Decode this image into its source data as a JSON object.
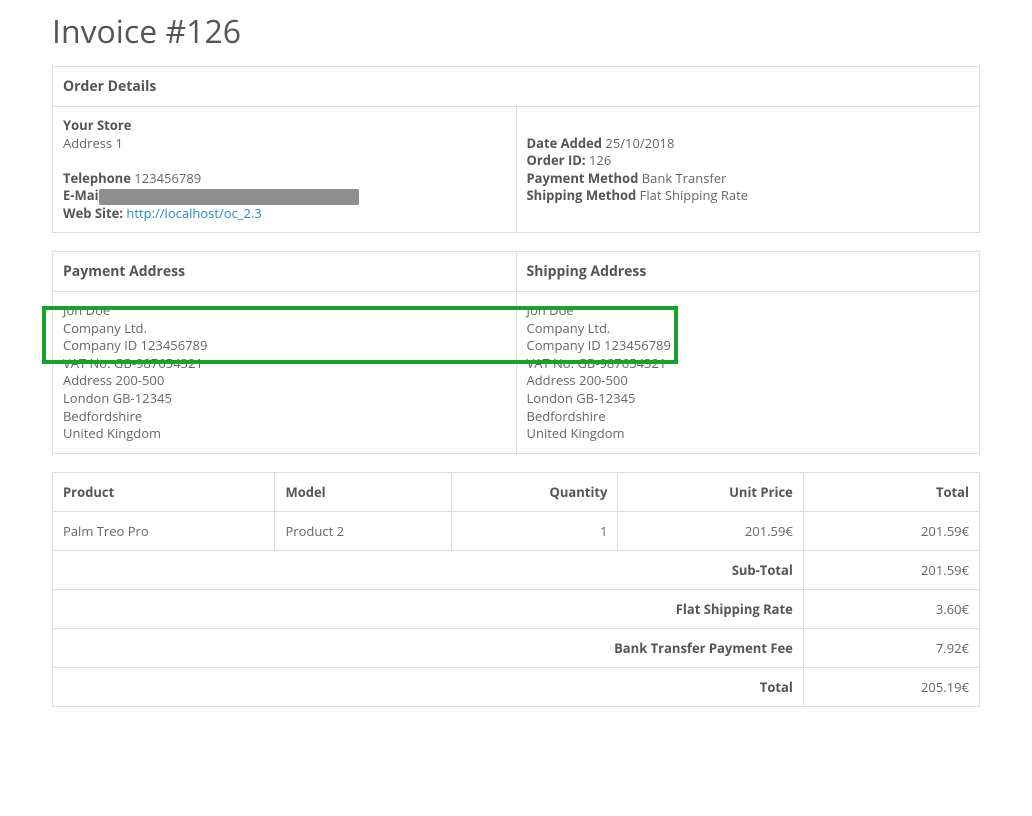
{
  "title": "Invoice #126",
  "orderDetailsHeader": "Order Details",
  "store": {
    "nameLabel": "Your Store",
    "address": "Address 1",
    "telephoneLabel": "Telephone",
    "telephoneValue": "123456789",
    "emailLabel": "E-Mai",
    "websiteLabel": "Web Site:",
    "websiteUrl": "http://localhost/oc_2.3"
  },
  "order": {
    "dateAddedLabel": "Date Added",
    "dateAddedValue": "25/10/2018",
    "orderIdLabel": "Order ID:",
    "orderIdValue": "126",
    "paymentMethodLabel": "Payment Method",
    "paymentMethodValue": "Bank Transfer",
    "shippingMethodLabel": "Shipping Method",
    "shippingMethodValue": "Flat Shipping Rate"
  },
  "paymentAddressHeader": "Payment Address",
  "shippingAddressHeader": "Shipping Address",
  "paymentAddress": {
    "l1": "Jon Doe",
    "l2": "Company Ltd.",
    "l3": "Company ID 123456789",
    "l4": "VAT No. GB-987654321",
    "l5": "Address 200-500",
    "l6": "London GB-12345",
    "l7": "Bedfordshire",
    "l8": "United Kingdom"
  },
  "shippingAddress": {
    "l1": "Jon Doe",
    "l2": "Company Ltd.",
    "l3": "Company ID 123456789",
    "l4": "VAT No. GB-987654321",
    "l5": "Address 200-500",
    "l6": "London GB-12345",
    "l7": "Bedfordshire",
    "l8": "United Kingdom"
  },
  "items": {
    "headers": {
      "product": "Product",
      "model": "Model",
      "quantity": "Quantity",
      "unitPrice": "Unit Price",
      "total": "Total"
    },
    "rows": [
      {
        "product": "Palm Treo Pro",
        "model": "Product 2",
        "quantity": "1",
        "unitPrice": "201.59€",
        "total": "201.59€"
      }
    ],
    "totals": [
      {
        "label": "Sub-Total",
        "value": "201.59€"
      },
      {
        "label": "Flat Shipping Rate",
        "value": "3.60€"
      },
      {
        "label": "Bank Transfer Payment Fee",
        "value": "7.92€"
      },
      {
        "label": "Total",
        "value": "205.19€"
      }
    ]
  }
}
